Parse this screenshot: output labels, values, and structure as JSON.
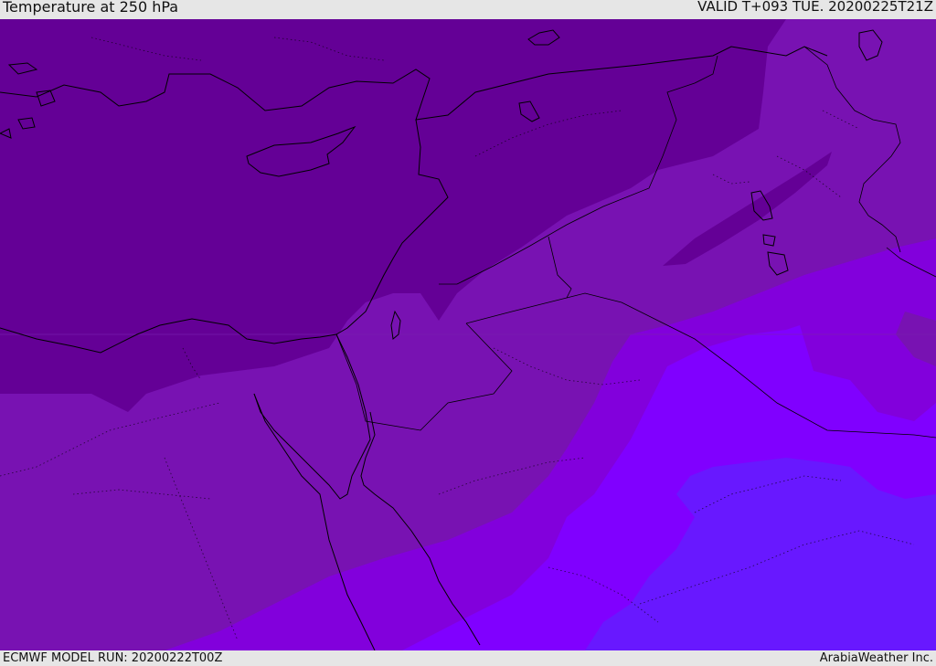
{
  "header": {
    "title": "Temperature at 250 hPa",
    "valid": "VALID T+093 TUE. 20200225T21Z"
  },
  "footer": {
    "model_run": "ECMWF MODEL RUN: 20200222T00Z",
    "credit": "ArabiaWeather Inc."
  },
  "colors": {
    "zone_darkest": "#640096",
    "zone_dark": "#7812b2",
    "zone_mid": "#8200dc",
    "zone_bright": "#8000ff",
    "zone_blue": "#6818ff",
    "coastline": "#000000",
    "header_bg": "#e6e6e6"
  }
}
